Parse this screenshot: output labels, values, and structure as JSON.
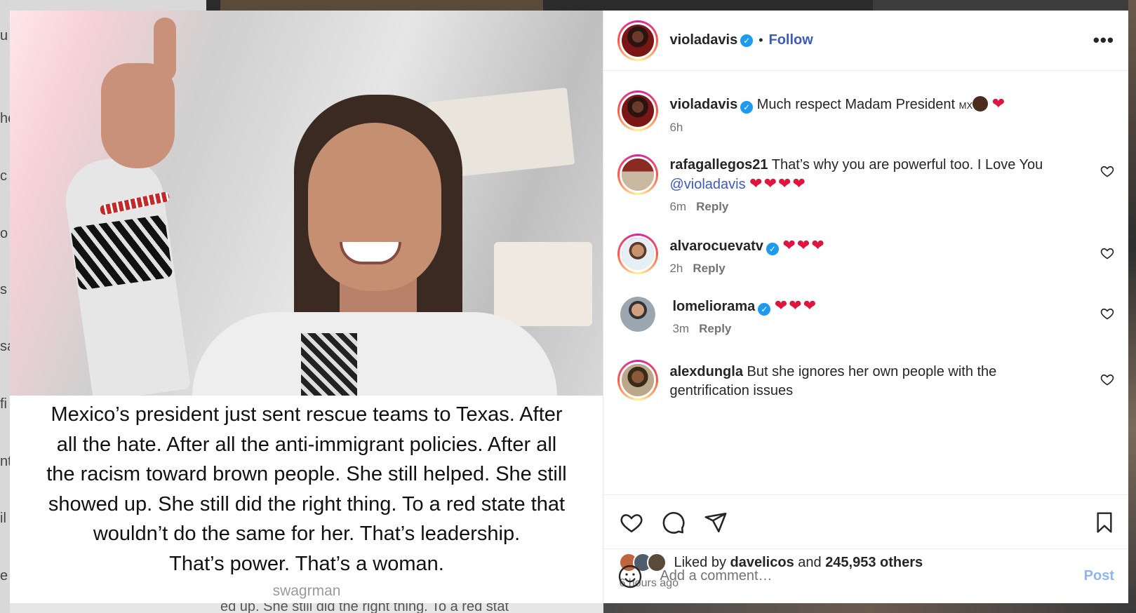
{
  "backdrop": {
    "left_fragments": [
      "u",
      "he",
      "c",
      "o",
      "s",
      "sa",
      "fi",
      "nt",
      "il",
      "e"
    ],
    "bottom_fragment": "ed up. She still did the right thing. To a red stat"
  },
  "post": {
    "caption_lines": [
      "Mexico’s president just sent rescue teams to Texas. After",
      "all the hate. After all the anti-immigrant policies. After all",
      "the racism toward brown people. She still helped. She still",
      "showed up. She still did the right thing. To a red state that",
      "wouldn’t do the same for her. That’s leadership.",
      "That’s power. That’s a woman."
    ],
    "credit": "swagrman"
  },
  "header": {
    "username": "violadavis",
    "separator": "•",
    "follow_label": "Follow",
    "more_label": "•••"
  },
  "comments": [
    {
      "username": "violadavis",
      "verified": true,
      "text": "Much respect Madam President ",
      "flag": "MX",
      "emoji": "❤",
      "time": "6h",
      "reply": ""
    },
    {
      "username": "rafagallegos21",
      "verified": false,
      "text": "That’s why you are powerful too. I Love You",
      "mention": "@violadavis",
      "emoji": "❤❤❤❤",
      "time": "6m",
      "reply": "Reply"
    },
    {
      "username": "alvarocuevatv",
      "verified": true,
      "text": "",
      "emoji": "❤❤❤",
      "time": "2h",
      "reply": "Reply"
    },
    {
      "username": "lomeliorama",
      "verified": true,
      "text": "",
      "emoji": "❤❤❤",
      "time": "3m",
      "reply": "Reply"
    },
    {
      "username": "alexdungla",
      "verified": false,
      "text": "But she ignores her own people with the gentrification issues",
      "emoji": "",
      "time": "",
      "reply": ""
    }
  ],
  "likes": {
    "prefix": "Liked by ",
    "user": "davelicos",
    "middle": " and ",
    "count": "245,953 others",
    "time_ago": "6 hours ago"
  },
  "add_comment": {
    "placeholder": "Add a comment…",
    "post_label": "Post"
  },
  "colors": {
    "accent": "#3b5ac4",
    "verified": "#1d9bf0",
    "heart": "#e0143c",
    "post_disabled": "#8fb5f0"
  }
}
